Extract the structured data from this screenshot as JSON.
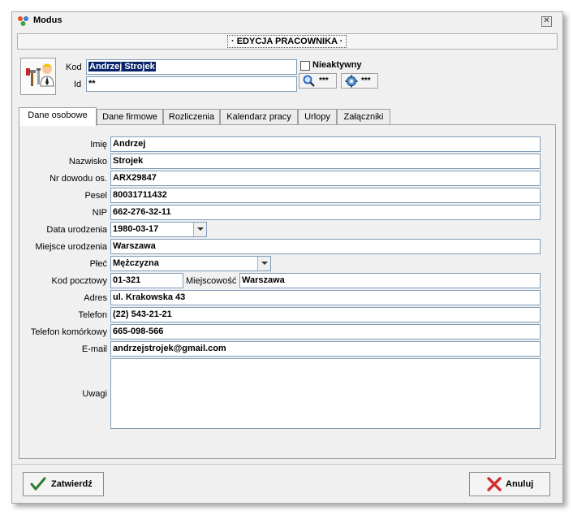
{
  "window": {
    "title": "Modus",
    "close_glyph": "✕"
  },
  "header": {
    "title": "· EDYCJA PRACOWNIKA ·"
  },
  "top": {
    "kod_label": "Kod",
    "kod_value": "Andrzej Strojek",
    "id_label": "Id",
    "id_value": "**",
    "inactive_label": "Nieaktywny",
    "search_button_label": "***",
    "settings_button_label": "***"
  },
  "tabs": [
    {
      "label": "Dane osobowe",
      "active": true
    },
    {
      "label": "Dane firmowe"
    },
    {
      "label": "Rozliczenia"
    },
    {
      "label": "Kalendarz pracy"
    },
    {
      "label": "Urlopy"
    },
    {
      "label": "Załączniki"
    }
  ],
  "form": {
    "imie": {
      "label": "Imię",
      "value": "Andrzej"
    },
    "nazwisko": {
      "label": "Nazwisko",
      "value": "Strojek"
    },
    "nr_dowodu": {
      "label": "Nr dowodu os.",
      "value": "ARX29847"
    },
    "pesel": {
      "label": "Pesel",
      "value": "80031711432"
    },
    "nip": {
      "label": "NIP",
      "value": "662-276-32-11"
    },
    "data_urodzenia": {
      "label": "Data urodzenia",
      "value": "1980-03-17"
    },
    "miejsce_urodzenia": {
      "label": "Miejsce urodzenia",
      "value": "Warszawa"
    },
    "plec": {
      "label": "Płeć",
      "value": "Mężczyzna"
    },
    "kod_pocztowy": {
      "label": "Kod pocztowy",
      "value": "01-321"
    },
    "miejscowosc": {
      "label": "Miejscowość",
      "value": "Warszawa"
    },
    "adres": {
      "label": "Adres",
      "value": "ul. Krakowska 43"
    },
    "telefon": {
      "label": "Telefon",
      "value": "(22) 543-21-21"
    },
    "telefon_komorkowy": {
      "label": "Telefon komórkowy",
      "value": "665-098-566"
    },
    "email": {
      "label": "E-mail",
      "value": "andrzejstrojek@gmail.com"
    },
    "uwagi": {
      "label": "Uwagi",
      "value": ""
    }
  },
  "footer": {
    "confirm_label": "Zatwierdź",
    "cancel_label": "Anuluj"
  },
  "colors": {
    "selection": "#0a246a",
    "input_border": "#7f9db9",
    "confirm_icon": "#2e7d32",
    "cancel_icon": "#d32f2f"
  },
  "icons": [
    "app-icon",
    "user-worker-icon",
    "search-icon",
    "settings-icon",
    "checkmark-icon",
    "cross-icon",
    "close-icon",
    "dropdown-arrow-icon"
  ]
}
